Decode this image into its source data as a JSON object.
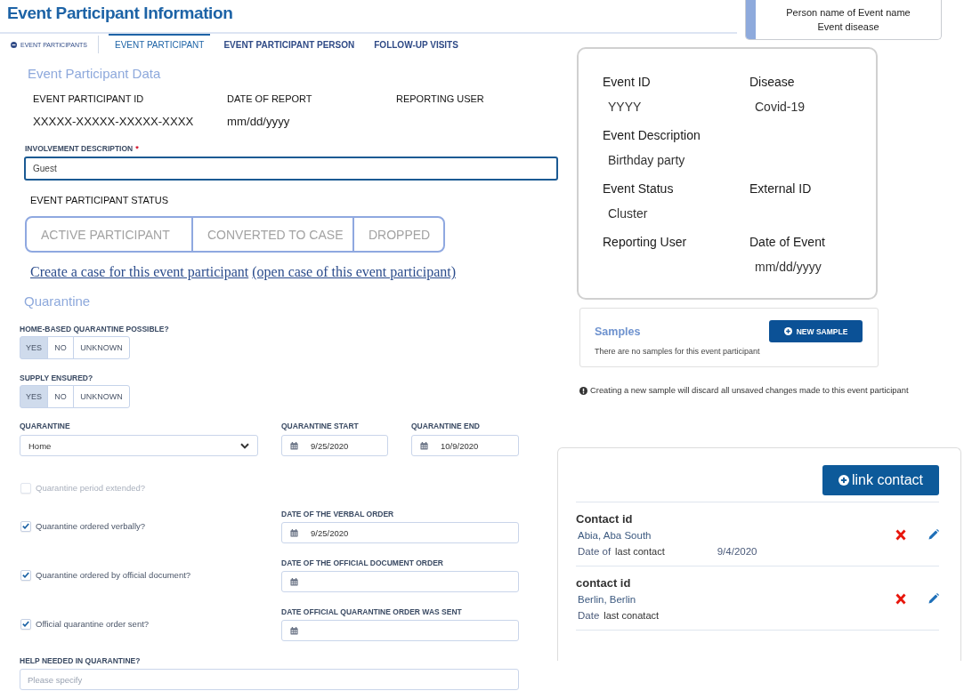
{
  "header": {
    "title": "Event Participant Information"
  },
  "summary_card": {
    "line_1": "Person name of Event name",
    "line_2": "Event disease"
  },
  "tabs": {
    "back_link": "EVENT PARTICIPANTS",
    "items": [
      {
        "label": "EVENT PARTICIPANT",
        "selected": true
      },
      {
        "label": "EVENT PARTICIPANT PERSON",
        "selected": false
      },
      {
        "label": "FOLLOW-UP VISITS",
        "selected": false
      }
    ]
  },
  "participant_data": {
    "heading": "Event Participant Data",
    "fields": [
      {
        "label": "EVENT PARTICIPANT ID",
        "value": "XXXXX-XXXXX-XXXXX-XXXX"
      },
      {
        "label": "DATE OF REPORT",
        "value": "mm/dd/yyyy"
      },
      {
        "label": "REPORTING USER"
      }
    ],
    "involvement": {
      "label": "INVOLVEMENT DESCRIPTION",
      "required_mark": "*",
      "value": "Guest"
    },
    "status": {
      "label": "EVENT PARTICIPANT STATUS",
      "options": [
        {
          "label": "ACTIVE PARTICIPANT",
          "selected": false
        },
        {
          "label": "CONVERTED TO CASE",
          "selected": false
        },
        {
          "label": "DROPPED",
          "selected": false
        }
      ]
    },
    "links": [
      "Create a case for this event participant",
      "(open case of this event participant)"
    ]
  },
  "quarantine": {
    "heading": "Quarantine",
    "toggles": [
      {
        "label": "HOME-BASED QUARANTINE POSSIBLE?",
        "options": [
          {
            "label": "YES",
            "selected": true
          },
          {
            "label": "NO",
            "selected": false
          },
          {
            "label": "UNKNOWN",
            "selected": false
          }
        ]
      },
      {
        "label": "SUPPLY ENSURED?",
        "options": [
          {
            "label": "YES",
            "selected": true
          },
          {
            "label": "NO",
            "selected": false
          },
          {
            "label": "UNKNOWN",
            "selected": false
          }
        ]
      }
    ],
    "type_field": {
      "label": "QUARANTINE",
      "value": "Home"
    },
    "start_field": {
      "label": "QUARANTINE START",
      "value": "9/25/2020"
    },
    "end_field": {
      "label": "QUARANTINE END",
      "value": "10/9/2020"
    },
    "checks": [
      {
        "label": "Quarantine period extended?",
        "checked": false,
        "disabled": true
      },
      {
        "label": "Quarantine ordered verbally?",
        "checked": true,
        "disabled": false,
        "date_field": {
          "label": "DATE OF THE VERBAL ORDER",
          "value": "9/25/2020"
        }
      },
      {
        "label": "Quarantine ordered by official document?",
        "checked": true,
        "disabled": false,
        "date_field": {
          "label": "DATE OF THE OFFICIAL DOCUMENT ORDER"
        }
      },
      {
        "label": "Official quarantine order sent?",
        "checked": true,
        "disabled": false,
        "date_field": {
          "label": "DATE OFFICIAL QUARANTINE ORDER WAS SENT"
        }
      }
    ],
    "help_field": {
      "label": "HELP NEEDED IN QUARANTINE?",
      "placeholder": "Please specify"
    }
  },
  "event_card": {
    "rows": [
      {
        "cells": [
          {
            "label": "Event ID",
            "value": "YYYY"
          },
          {
            "label": "Disease",
            "value": "Covid-19"
          }
        ]
      },
      {
        "cells": [
          {
            "label": "Event Description",
            "value": "Birthday party"
          }
        ]
      },
      {
        "cells": [
          {
            "label": "Event Status",
            "value": "Cluster"
          },
          {
            "label": "External ID"
          }
        ]
      },
      {
        "cells": [
          {
            "label": "Reporting User"
          },
          {
            "label": "Date of Event",
            "value": "mm/dd/yyyy"
          }
        ]
      }
    ]
  },
  "samples": {
    "heading": "Samples",
    "button": "NEW SAMPLE",
    "empty_text": "There are no samples for this event participant",
    "notice": "Creating a new sample will discard all unsaved changes made to this event participant"
  },
  "contacts": {
    "button": "link contact",
    "items": [
      {
        "id_label": "Contact id",
        "location": "Abia, Aba South",
        "date_label": "Date of",
        "date_note": "last contact",
        "date": "9/4/2020"
      },
      {
        "id_label": "contact id",
        "location": "Berlin, Berlin",
        "date_label": "Date",
        "date_note": "last conatact"
      }
    ]
  }
}
